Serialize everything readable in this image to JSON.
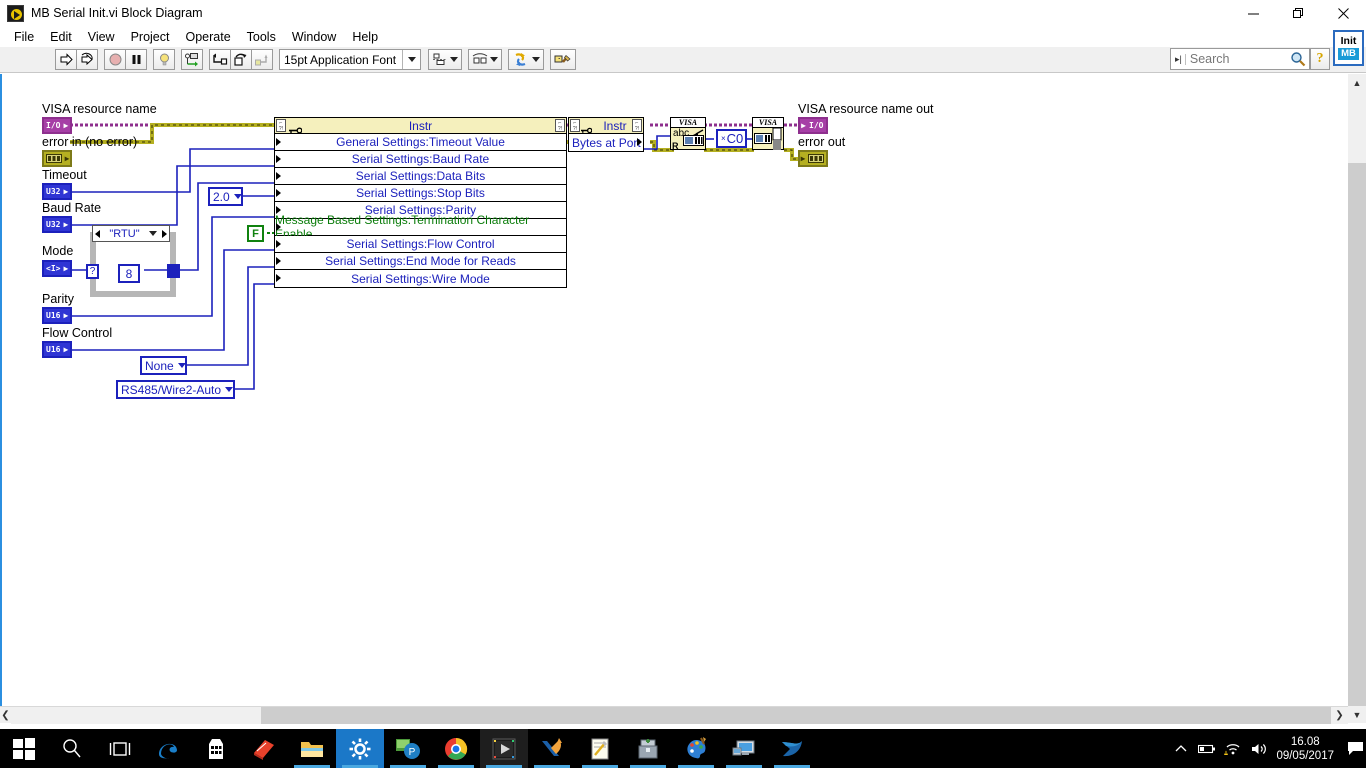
{
  "window": {
    "title": "MB Serial Init.vi Block Diagram",
    "icon": "labview-vi-icon",
    "controls": {
      "minimize": "minimize-icon",
      "maximize": "restore-icon",
      "close": "close-icon"
    }
  },
  "menubar": {
    "items": [
      "File",
      "Edit",
      "View",
      "Project",
      "Operate",
      "Tools",
      "Window",
      "Help"
    ]
  },
  "toolbar": {
    "buttons": [
      "run-button",
      "run-continuously-button",
      "abort-execution-button",
      "pause-button",
      "highlight-execution-button",
      "retain-wire-values-button",
      "step-into-button",
      "step-over-button",
      "step-out-button"
    ],
    "font_selector": "15pt Application Font",
    "align_objects": "align-objects-dropdown",
    "distribute_objects": "distribute-objects-dropdown",
    "reorder": "reorder-dropdown",
    "clean_up_diagram": "clean-up-diagram-button"
  },
  "search": {
    "placeholder": "Search",
    "icon": "search-icon"
  },
  "help_button": {
    "label": "?"
  },
  "vi_icon": {
    "top": "Init",
    "bottom": "MB"
  },
  "diagram": {
    "terminals": [
      {
        "label": "VISA resource name",
        "type": "I/O",
        "kind": "io"
      },
      {
        "label": "error in (no error)",
        "type": "",
        "kind": "error"
      },
      {
        "label": "Timeout",
        "type": "U32",
        "kind": "num"
      },
      {
        "label": "Baud Rate",
        "type": "U32",
        "kind": "num"
      },
      {
        "label": "Mode",
        "type": "<I>",
        "kind": "num"
      },
      {
        "label": "Parity",
        "type": "U16",
        "kind": "num"
      },
      {
        "label": "Flow Control",
        "type": "U16",
        "kind": "num"
      }
    ],
    "outputs": [
      {
        "label": "VISA resource name out",
        "type": "I/O",
        "kind": "io"
      },
      {
        "label": "error out",
        "type": "",
        "kind": "error"
      }
    ],
    "constants": [
      {
        "name": "stop-bits-constant",
        "value": "2.0",
        "style": "enum"
      },
      {
        "name": "term-char-constant",
        "value": "F",
        "style": "boolean"
      },
      {
        "name": "data-bits-constant",
        "value": "8",
        "style": "numeric"
      },
      {
        "name": "end-mode-constant",
        "value": "None",
        "style": "enum"
      },
      {
        "name": "wire-mode-constant",
        "value": "RS485/Wire2-Auto",
        "style": "enum"
      },
      {
        "name": "close-constant",
        "value": "C0",
        "style": "numeric"
      }
    ],
    "case_structure": {
      "selector": "\"RTU\"",
      "prev": "left-arrow-icon",
      "next": "right-arrow-icon"
    },
    "property_node_1": {
      "class": "Instr",
      "properties": [
        {
          "name": "General Settings:Timeout Value",
          "color": "blue"
        },
        {
          "name": "Serial Settings:Baud Rate",
          "color": "blue"
        },
        {
          "name": "Serial Settings:Data Bits",
          "color": "blue"
        },
        {
          "name": "Serial Settings:Stop Bits",
          "color": "blue"
        },
        {
          "name": "Serial Settings:Parity",
          "color": "blue"
        },
        {
          "name": "Message Based Settings:Termination Character Enable",
          "color": "green"
        },
        {
          "name": "Serial Settings:Flow Control",
          "color": "blue"
        },
        {
          "name": "Serial Settings:End Mode for Reads",
          "color": "blue"
        },
        {
          "name": "Serial Settings:Wire Mode",
          "color": "blue"
        }
      ]
    },
    "property_node_2": {
      "class": "Instr",
      "properties": [
        {
          "name": "Bytes at Port",
          "color": "blue"
        }
      ]
    },
    "visa_nodes": [
      {
        "name": "visa-read-node",
        "top": "VISA",
        "body": "abc",
        "sub": "R"
      },
      {
        "name": "visa-close-node",
        "top": "VISA",
        "body": ""
      }
    ]
  },
  "scrollbars": {
    "horizontal": "horizontal-scrollbar",
    "vertical": "vertical-scrollbar"
  },
  "taskbar": {
    "items": [
      "start-button",
      "search-icon",
      "task-view-icon",
      "edge-icon",
      "store-icon",
      "reader-icon",
      "file-explorer-icon",
      "settings-icon",
      "teamviewer-icon",
      "chrome-icon",
      "labview-icon",
      "xctu-icon",
      "notepad-icon",
      "archive-icon",
      "paint-icon",
      "remote-desktop-icon",
      "app-icon"
    ],
    "tray": [
      "show-hidden-icons",
      "battery-icon",
      "network-warning-icon",
      "volume-icon",
      "action-center-icon"
    ],
    "clock": {
      "time": "16.08",
      "date": "09/05/2017"
    }
  },
  "colors": {
    "accent": "#2b8fe0",
    "wire_blue": "#1c21bc",
    "wire_purple": "#8e2f8e",
    "wire_error": "#b5b021",
    "node_yellow": "#f5f0bd",
    "green_text": "#0b7d0b"
  }
}
